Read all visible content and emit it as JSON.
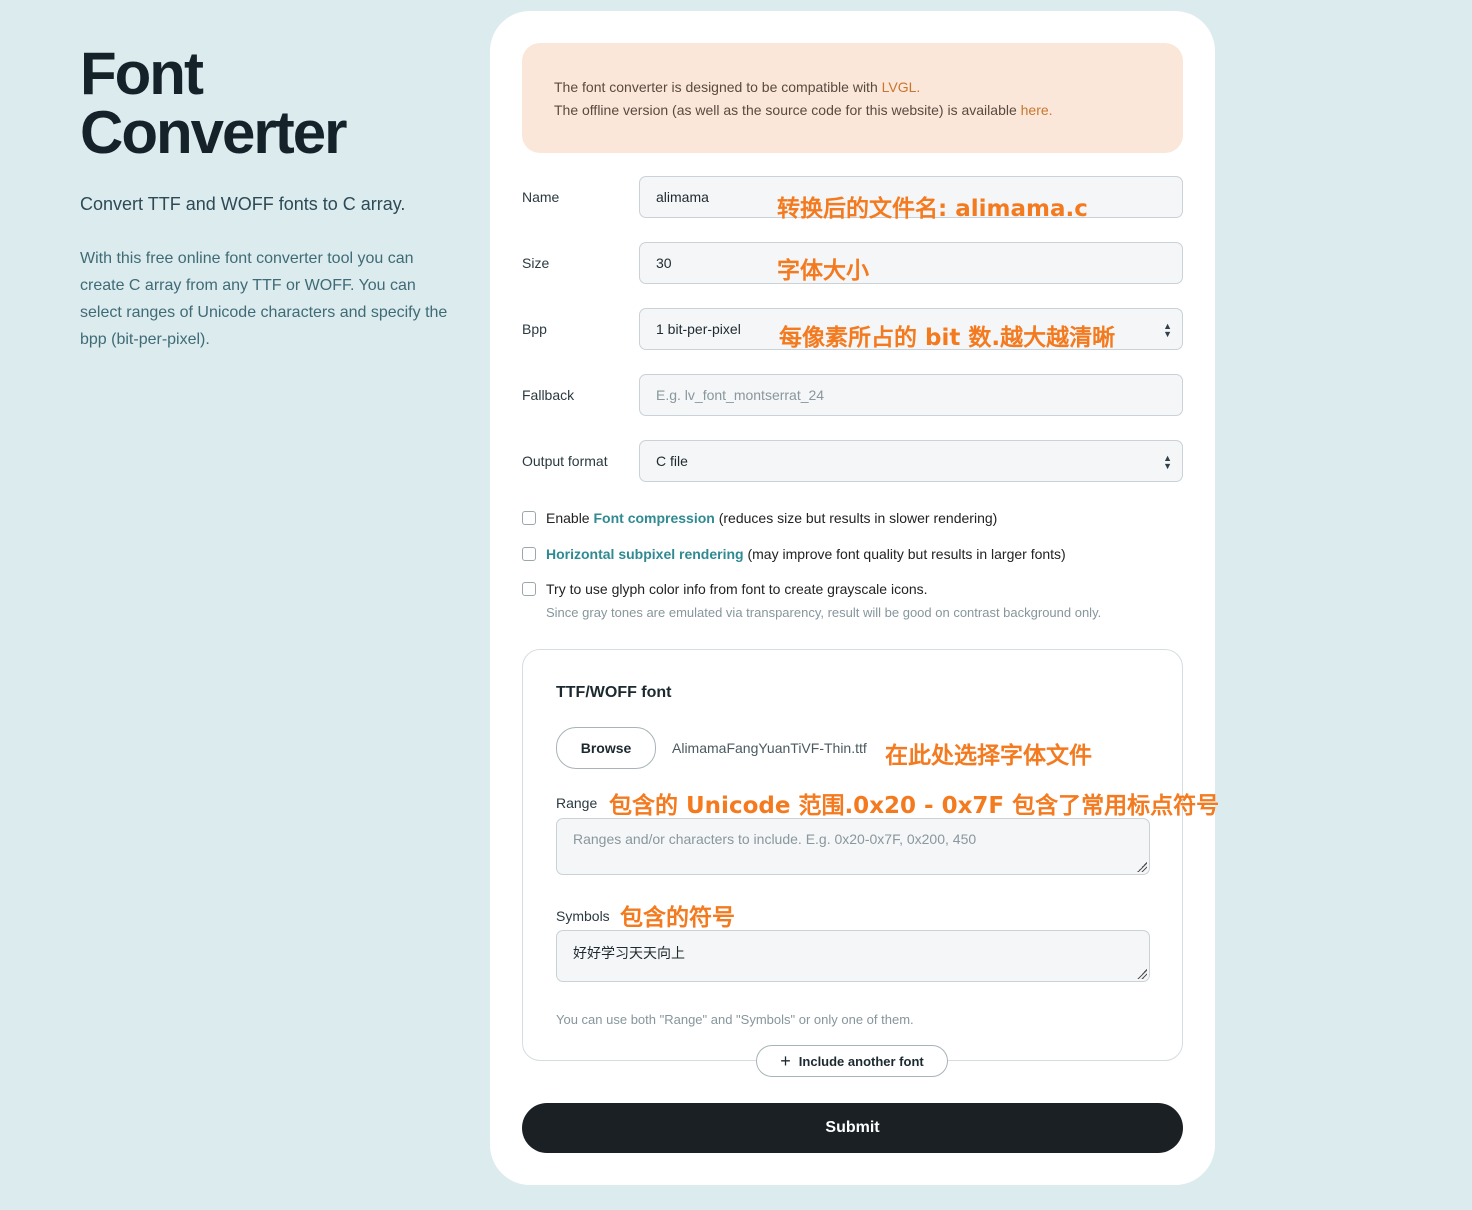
{
  "left": {
    "title_line1": "Font",
    "title_line2": "Converter",
    "subtitle": "Convert TTF and WOFF fonts to C array.",
    "description": "With this free online font converter tool you can create C array from any TTF or WOFF. You can select ranges of Unicode characters and specify the bpp (bit-per-pixel)."
  },
  "notice": {
    "line1_prefix": "The font converter is designed to be compatible with ",
    "line1_link": "LVGL.",
    "line2_prefix": "The offline version (as well as the source code for this website) is available ",
    "line2_link": "here."
  },
  "form": {
    "name_label": "Name",
    "name_value": "alimama",
    "size_label": "Size",
    "size_value": "30",
    "bpp_label": "Bpp",
    "bpp_value": "1 bit-per-pixel",
    "fallback_label": "Fallback",
    "fallback_placeholder": "E.g. lv_font_montserrat_24",
    "output_label": "Output format",
    "output_value": "C file"
  },
  "annotations": {
    "name": "转换后的文件名: alimama.c",
    "size": "字体大小",
    "bpp": "每像素所占的 bit 数.越大越清晰",
    "browse": "在此处选择字体文件",
    "range": "包含的 Unicode 范围.0x20 - 0x7F 包含了常用标点符号",
    "symbols": "包含的符号"
  },
  "options": {
    "compression_prefix": "Enable ",
    "compression_link": "Font compression",
    "compression_suffix": " (reduces size but results in slower rendering)",
    "subpixel_link": "Horizontal subpixel rendering",
    "subpixel_suffix": " (may improve font quality but results in larger fonts)",
    "glyph_color": "Try to use glyph color info from font to create grayscale icons.",
    "glyph_note": "Since gray tones are emulated via transparency, result will be good on contrast background only."
  },
  "font_box": {
    "title": "TTF/WOFF font",
    "browse_label": "Browse",
    "file_name": "AlimamaFangYuanTiVF-Thin.ttf",
    "range_label": "Range",
    "range_placeholder": "Ranges and/or characters to include. E.g. 0x20-0x7F, 0x200, 450",
    "symbols_label": "Symbols",
    "symbols_value": "好好学习天天向上",
    "note": "You can use both \"Range\" and \"Symbols\" or only one of them."
  },
  "include_label": "Include another font",
  "submit_label": "Submit",
  "colors": {
    "accent_link": "#2f8a92",
    "annotation": "#f47a1f",
    "notice_bg": "#fbe7da",
    "page_bg": "#dcebee"
  }
}
